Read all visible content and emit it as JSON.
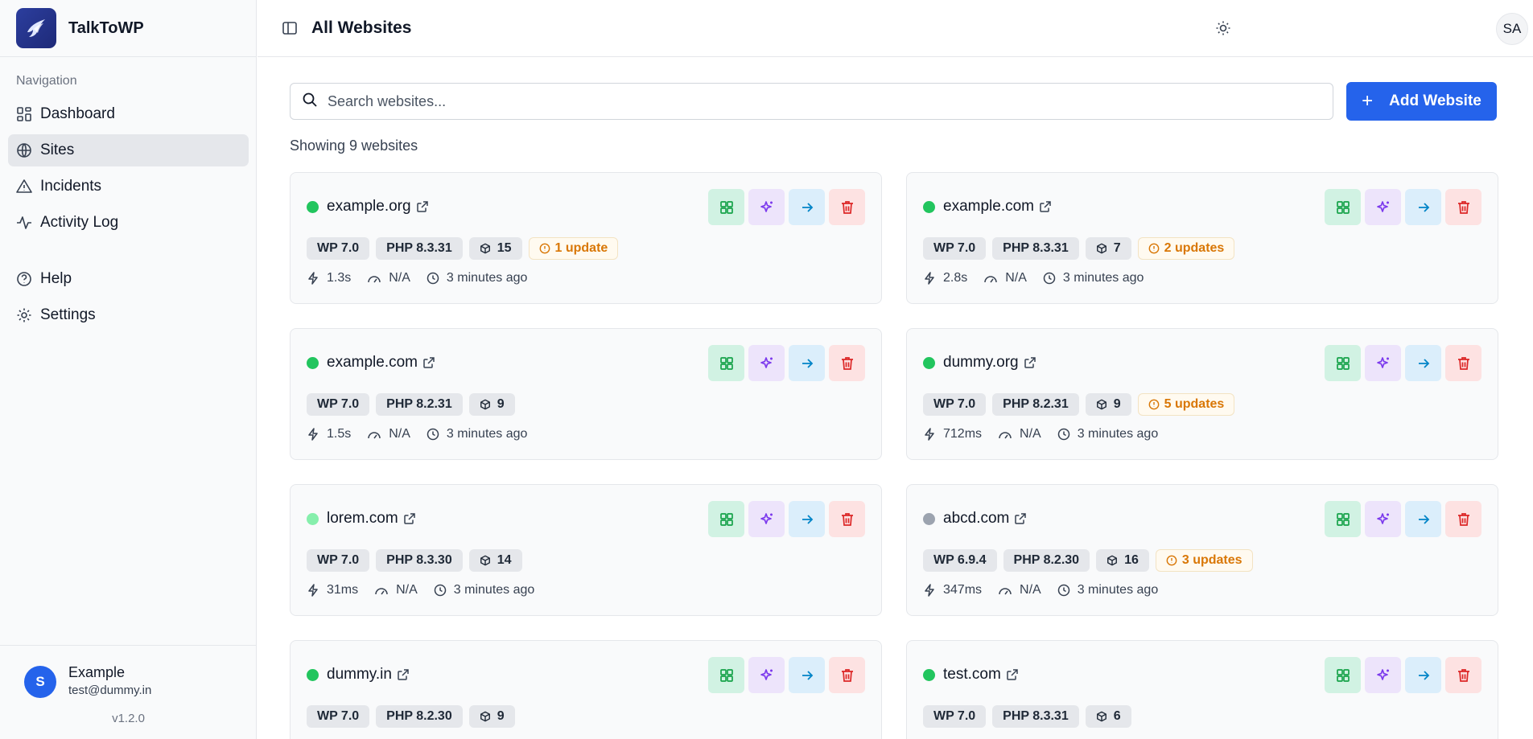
{
  "brand": {
    "name": "TalkToWP"
  },
  "nav": {
    "section_label": "Navigation",
    "items": [
      {
        "label": "Dashboard",
        "icon": "dashboard-icon"
      },
      {
        "label": "Sites",
        "icon": "globe-icon",
        "active": true
      },
      {
        "label": "Incidents",
        "icon": "alert-triangle-icon"
      },
      {
        "label": "Activity Log",
        "icon": "activity-icon"
      },
      {
        "label": "Help",
        "icon": "help-circle-icon"
      },
      {
        "label": "Settings",
        "icon": "gear-icon"
      }
    ]
  },
  "user": {
    "initial": "S",
    "name": "Example",
    "email": "test@dummy.in",
    "version": "v1.2.0"
  },
  "header": {
    "title": "All Websites",
    "avatar_initials": "SA"
  },
  "toolbar": {
    "search_placeholder": "Search websites...",
    "add_label": "Add Website"
  },
  "summary": {
    "showing_text": "Showing 9 websites"
  },
  "colors": {
    "accent": "#2563eb",
    "status_up": "#22c55e",
    "status_pending": "#86efac",
    "status_unknown": "#9ca3af",
    "update": "#d97706"
  },
  "sites": [
    {
      "name": "example.org",
      "status": "up",
      "wp": "WP 7.0",
      "php": "PHP 8.3.31",
      "plugins": "15",
      "updates": "1 update",
      "response": "1.3s",
      "perf": "N/A",
      "checked": "3 minutes ago"
    },
    {
      "name": "example.com",
      "status": "up",
      "wp": "WP 7.0",
      "php": "PHP 8.3.31",
      "plugins": "7",
      "updates": "2 updates",
      "response": "2.8s",
      "perf": "N/A",
      "checked": "3 minutes ago"
    },
    {
      "name": "example.com",
      "status": "up",
      "wp": "WP 7.0",
      "php": "PHP 8.2.31",
      "plugins": "9",
      "updates": "",
      "response": "1.5s",
      "perf": "N/A",
      "checked": "3 minutes ago"
    },
    {
      "name": "dummy.org",
      "status": "up",
      "wp": "WP 7.0",
      "php": "PHP 8.2.31",
      "plugins": "9",
      "updates": "5 updates",
      "response": "712ms",
      "perf": "N/A",
      "checked": "3 minutes ago"
    },
    {
      "name": "lorem.com",
      "status": "pending",
      "wp": "WP 7.0",
      "php": "PHP 8.3.30",
      "plugins": "14",
      "updates": "",
      "response": "31ms",
      "perf": "N/A",
      "checked": "3 minutes ago"
    },
    {
      "name": "abcd.com",
      "status": "unknown",
      "wp": "WP 6.9.4",
      "php": "PHP 8.2.30",
      "plugins": "16",
      "updates": "3 updates",
      "response": "347ms",
      "perf": "N/A",
      "checked": "3 minutes ago"
    },
    {
      "name": "dummy.in",
      "status": "up",
      "wp": "WP 7.0",
      "php": "PHP 8.2.30",
      "plugins": "9",
      "updates": "",
      "response": "",
      "perf": "",
      "checked": ""
    },
    {
      "name": "test.com",
      "status": "up",
      "wp": "WP 7.0",
      "php": "PHP 8.3.31",
      "plugins": "6",
      "updates": "",
      "response": "",
      "perf": "",
      "checked": ""
    }
  ]
}
